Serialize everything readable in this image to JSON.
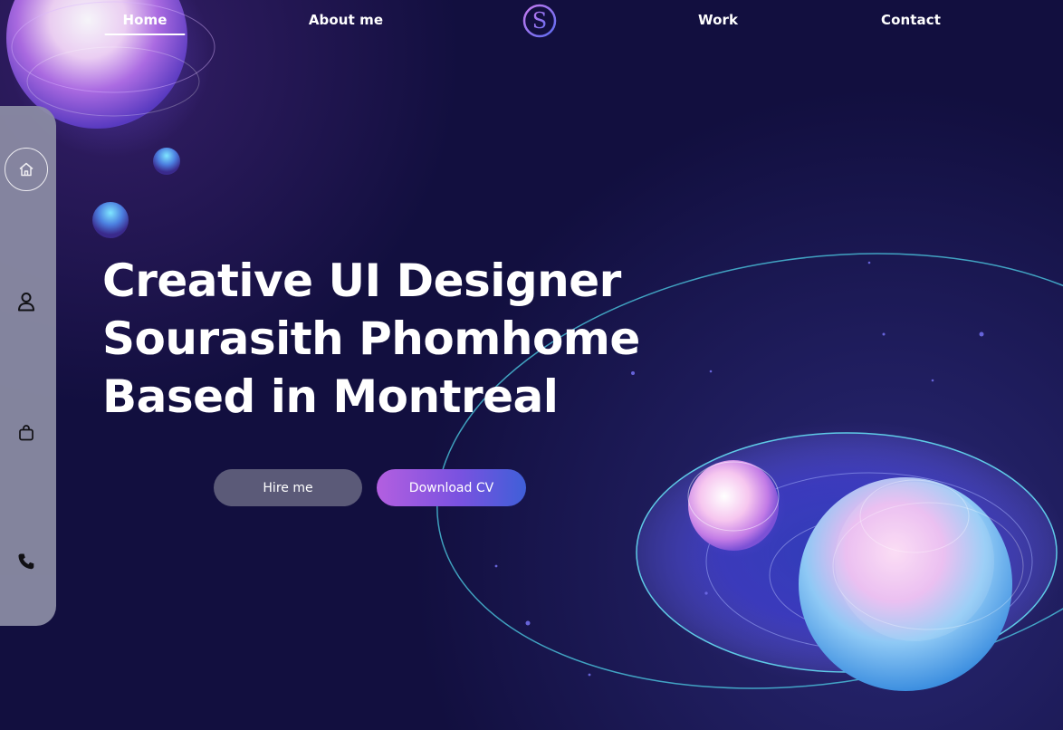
{
  "nav": {
    "items": [
      {
        "label": "Home",
        "active": true
      },
      {
        "label": "About me",
        "active": false
      },
      {
        "label": "Work",
        "active": false
      },
      {
        "label": "Contact",
        "active": false
      }
    ],
    "logo_letter": "S"
  },
  "side_rail": {
    "items": [
      {
        "icon": "home-icon",
        "active": true
      },
      {
        "icon": "user-icon",
        "active": false
      },
      {
        "icon": "bag-icon",
        "active": false
      },
      {
        "icon": "phone-icon",
        "active": false
      }
    ]
  },
  "hero": {
    "line1": "Creative UI Designer",
    "line2": "Sourasith Phomhome",
    "line3": "Based in Montreal"
  },
  "buttons": {
    "hire_label": "Hire me",
    "cv_label": "Download CV"
  },
  "colors": {
    "background": "#120f3f",
    "rail": "#8d8ea6",
    "hire_button": "#5b5a78",
    "cv_gradient_start": "#b35fe0",
    "cv_gradient_end": "#3f5fd8",
    "orbit": "#4fd1e8"
  }
}
